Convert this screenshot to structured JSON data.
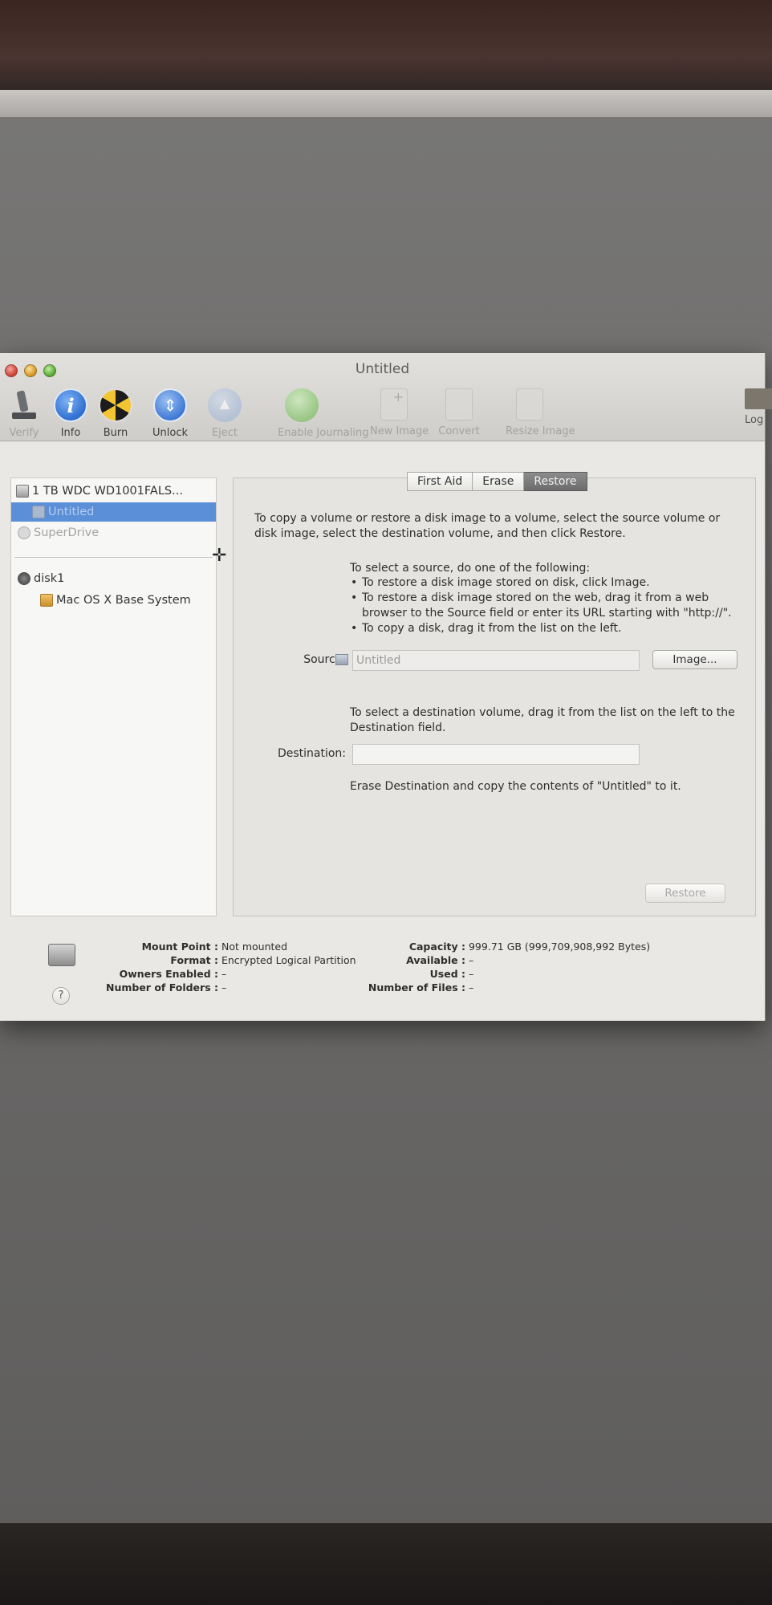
{
  "window": {
    "title": "Untitled"
  },
  "toolbar": {
    "items": [
      {
        "label": "Verify",
        "icon": "microscope-icon",
        "enabled": false
      },
      {
        "label": "Info",
        "icon": "info-icon",
        "enabled": true
      },
      {
        "label": "Burn",
        "icon": "burn-icon",
        "enabled": true
      },
      {
        "label": "Unlock",
        "icon": "unlock-icon",
        "enabled": true
      },
      {
        "label": "Eject",
        "icon": "eject-icon",
        "enabled": false
      },
      {
        "label": "Enable Journaling",
        "icon": "journaling-icon",
        "enabled": false
      },
      {
        "label": "New Image",
        "icon": "new-image-icon",
        "enabled": false
      },
      {
        "label": "Convert",
        "icon": "convert-icon",
        "enabled": false
      },
      {
        "label": "Resize Image",
        "icon": "resize-image-icon",
        "enabled": false
      }
    ],
    "log_label": "Log"
  },
  "sidebar": {
    "drive": "1 TB WDC WD1001FALS...",
    "selected": "Untitled",
    "superdrive": "SuperDrive",
    "disk1": "disk1",
    "base_system": "Mac OS X Base System"
  },
  "tabs": [
    "First Aid",
    "Erase",
    "Restore"
  ],
  "active_tab": "Restore",
  "restore": {
    "intro": "To copy a volume or restore a disk image to a volume, select the source volume or disk image, select the destination volume, and then click Restore.",
    "source_heading": "To select a source, do one of the following:",
    "bullets": [
      "To restore a disk image stored on disk, click Image.",
      "To restore a disk image stored on the web, drag it from a web browser to the Source field or enter its URL starting with \"http://\".",
      "To copy a disk, drag it from the list on the left."
    ],
    "source_label": "Source:",
    "source_value": "Untitled",
    "image_button": "Image...",
    "dest_heading": "To select a destination volume, drag it from the list on the left to the Destination field.",
    "dest_label": "Destination:",
    "dest_value": "",
    "erase_text": "Erase Destination and copy the contents of \"Untitled\" to it.",
    "restore_button": "Restore"
  },
  "info": {
    "mount_point_label": "Mount Point :",
    "mount_point_value": "Not mounted",
    "format_label": "Format :",
    "format_value": "Encrypted Logical Partition",
    "owners_label": "Owners Enabled :",
    "owners_value": "–",
    "folders_label": "Number of Folders :",
    "folders_value": "–",
    "capacity_label": "Capacity :",
    "capacity_value": "999.71 GB (999,709,908,992 Bytes)",
    "available_label": "Available :",
    "available_value": "–",
    "used_label": "Used :",
    "used_value": "–",
    "files_label": "Number of Files :",
    "files_value": "–",
    "help": "?"
  }
}
